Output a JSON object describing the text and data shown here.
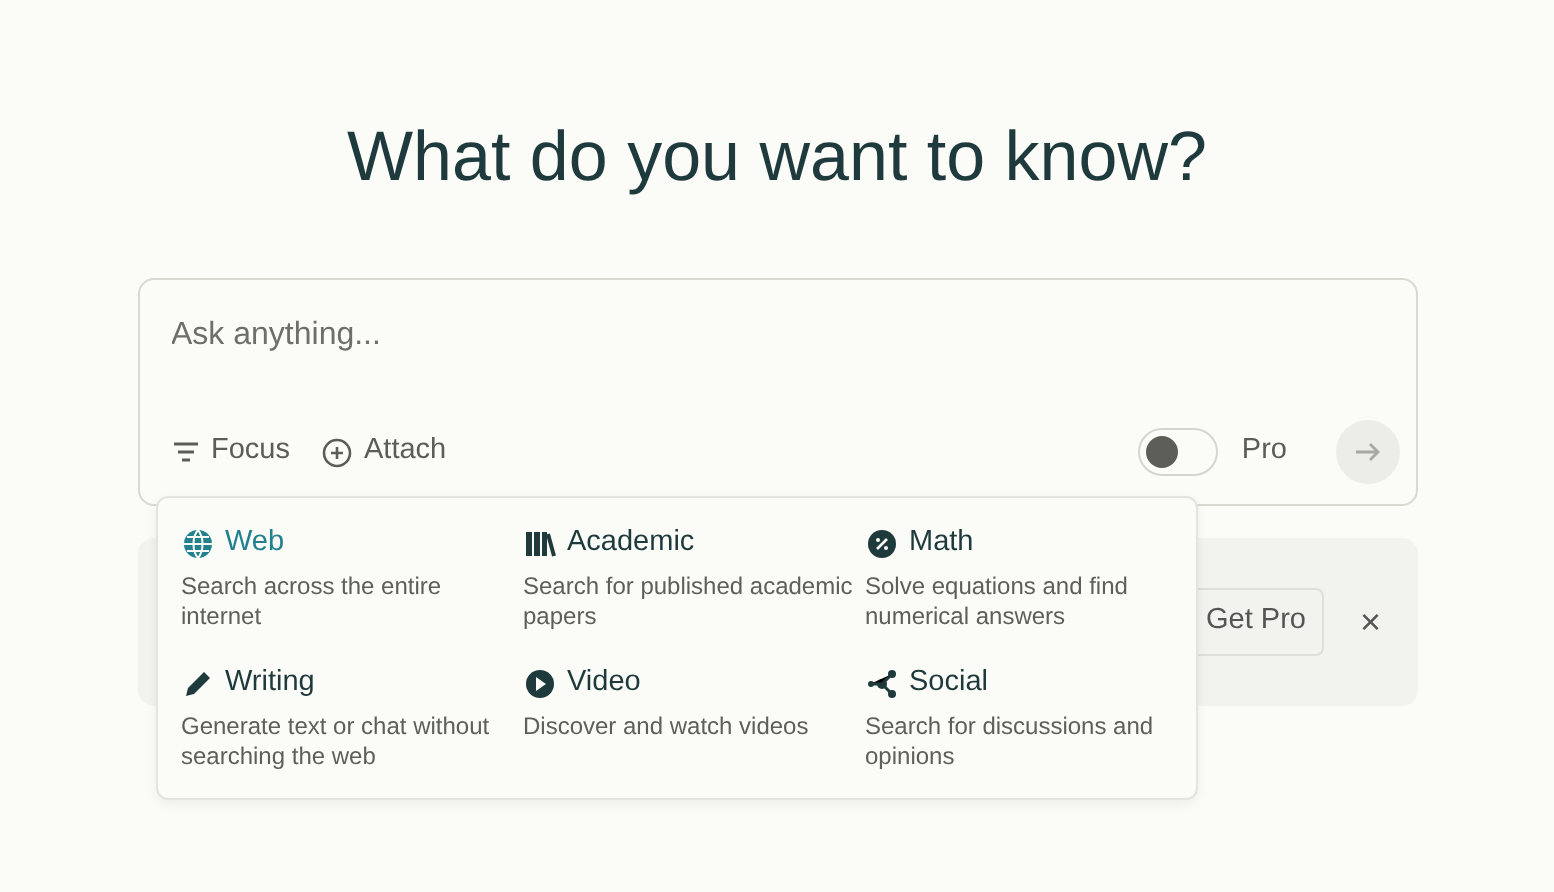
{
  "heading": "What do you want to know?",
  "search": {
    "placeholder": "Ask anything..."
  },
  "toolbar": {
    "focus_label": "Focus",
    "attach_label": "Attach",
    "pro_label": "Pro",
    "pro_on": false
  },
  "focus_options": [
    {
      "kind": "web",
      "title": "Web",
      "description": "Search across the entire internet",
      "selected": true
    },
    {
      "kind": "academic",
      "title": "Academic",
      "description": "Search for published academic papers",
      "selected": false
    },
    {
      "kind": "math",
      "title": "Math",
      "description": "Solve equations and find numerical answers",
      "selected": false
    },
    {
      "kind": "writing",
      "title": "Writing",
      "description": "Generate text or chat without searching the web",
      "selected": false
    },
    {
      "kind": "video",
      "title": "Video",
      "description": "Discover and watch videos",
      "selected": false
    },
    {
      "kind": "social",
      "title": "Social",
      "description": "Search for discussions and opinions",
      "selected": false
    }
  ],
  "banner": {
    "button": "Get Pro",
    "close": "×"
  }
}
